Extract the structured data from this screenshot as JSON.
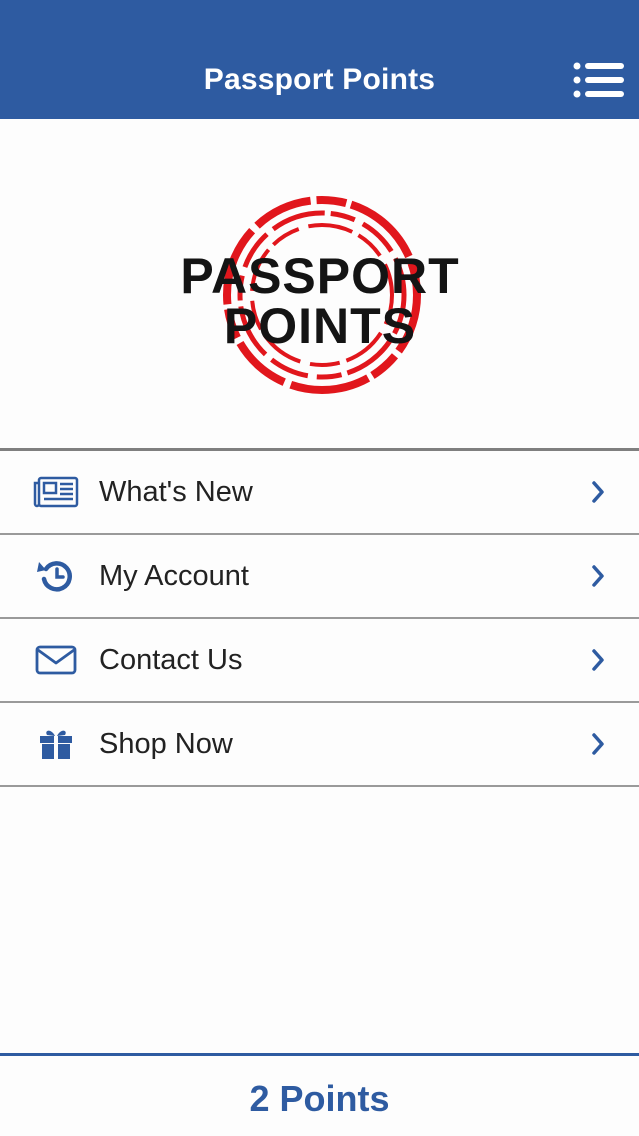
{
  "header": {
    "title": "Passport Points",
    "menu_icon": "list-menu-icon"
  },
  "logo": {
    "line1": "PASSPORT",
    "line2": "POINTS",
    "ring_color": "#e1161c",
    "text_color": "#141414"
  },
  "menu": {
    "items": [
      {
        "label": "What's New",
        "icon": "newspaper-icon"
      },
      {
        "label": "My Account",
        "icon": "history-icon"
      },
      {
        "label": "Contact Us",
        "icon": "envelope-icon"
      },
      {
        "label": "Shop Now",
        "icon": "gift-icon"
      }
    ],
    "chevron_icon": "chevron-right-icon"
  },
  "footer": {
    "points": "2 Points"
  },
  "colors": {
    "brand": "#2e5ba1",
    "divider": "#9a9a9a",
    "background": "#fdfdfd"
  }
}
